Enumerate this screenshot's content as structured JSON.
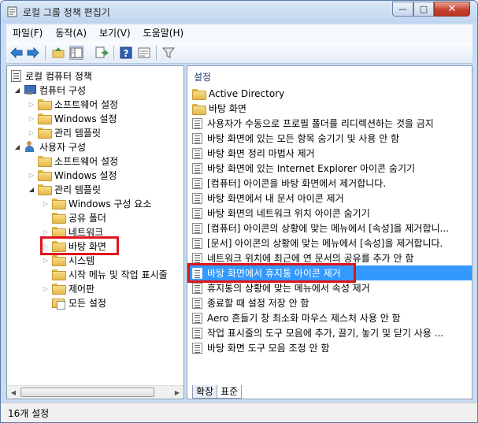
{
  "window": {
    "title": "로컬 그룹 정책 편집기"
  },
  "window_buttons": {
    "minimize": "—",
    "maximize": "□",
    "close": "✕"
  },
  "menu": [
    "파일(F)",
    "동작(A)",
    "보기(V)",
    "도움말(H)"
  ],
  "toolbar_icons": [
    "back-icon",
    "forward-icon",
    "up-folder-icon",
    "show-hide-tree-icon",
    "export-list-icon",
    "help-icon",
    "properties-icon",
    "filter-icon"
  ],
  "tree": {
    "root": "로컬 컴퓨터 정책",
    "items": [
      {
        "label": "컴퓨터 구성",
        "level": 1,
        "expander": "open",
        "icon": "computer"
      },
      {
        "label": "소프트웨어 설정",
        "level": 2,
        "expander": "closed",
        "icon": "folder"
      },
      {
        "label": "Windows 설정",
        "level": 2,
        "expander": "closed",
        "icon": "folder"
      },
      {
        "label": "관리 템플릿",
        "level": 2,
        "expander": "closed",
        "icon": "folder"
      },
      {
        "label": "사용자 구성",
        "level": 1,
        "expander": "open",
        "icon": "user"
      },
      {
        "label": "소프트웨어 설정",
        "level": 2,
        "expander": "none",
        "icon": "folder"
      },
      {
        "label": "Windows 설정",
        "level": 2,
        "expander": "closed",
        "icon": "folder"
      },
      {
        "label": "관리 템플릿",
        "level": 2,
        "expander": "open",
        "icon": "folder"
      },
      {
        "label": "Windows 구성 요소",
        "level": 3,
        "expander": "closed",
        "icon": "folder"
      },
      {
        "label": "공유 폴더",
        "level": 3,
        "expander": "none",
        "icon": "folder"
      },
      {
        "label": "네트워크",
        "level": 3,
        "expander": "closed",
        "icon": "folder"
      },
      {
        "label": "바탕 화면",
        "level": 3,
        "expander": "closed",
        "icon": "folder",
        "highlighted": true
      },
      {
        "label": "시스템",
        "level": 3,
        "expander": "closed",
        "icon": "folder"
      },
      {
        "label": "시작 메뉴 및 작업 표시줄",
        "level": 3,
        "expander": "none",
        "icon": "folder"
      },
      {
        "label": "제어판",
        "level": 3,
        "expander": "closed",
        "icon": "folder"
      },
      {
        "label": "모든 설정",
        "level": 3,
        "expander": "none",
        "icon": "special-folder"
      }
    ]
  },
  "list": {
    "header": "설정",
    "items": [
      {
        "label": "Active Directory",
        "icon": "folder"
      },
      {
        "label": "바탕 화면",
        "icon": "folder"
      },
      {
        "label": "사용자가 수동으로 프로필 폴더를 리디렉션하는 것을 금지",
        "icon": "policy"
      },
      {
        "label": "바탕 화면에 있는 모든 항목 숨기기 및 사용 안 함",
        "icon": "policy"
      },
      {
        "label": "바탕 화면 정리 마법사 제거",
        "icon": "policy"
      },
      {
        "label": "바탕 화면에 있는 Internet Explorer 아이콘 숨기기",
        "icon": "policy"
      },
      {
        "label": "[컴퓨터] 아이콘을 바탕 화면에서 제거합니다.",
        "icon": "policy"
      },
      {
        "label": "바탕 화면에서 내 문서 아이콘 제거",
        "icon": "policy"
      },
      {
        "label": "바탕 화면의 네트워크 위치 아이콘 숨기기",
        "icon": "policy"
      },
      {
        "label": "[컴퓨터] 아이콘의 상황에 맞는 메뉴에서 [속성]을 제거합니...",
        "icon": "policy"
      },
      {
        "label": "[문서] 아이콘의 상황에 맞는 메뉴에서 [속성]을 제거합니다.",
        "icon": "policy"
      },
      {
        "label": "네트워크 위치에 최근에 연 문서의 공유를 추가 안 함",
        "icon": "policy"
      },
      {
        "label": "바탕 화면에서 휴지통 아이콘 제거",
        "icon": "policy",
        "selected": true,
        "highlighted": true
      },
      {
        "label": "휴지통의 상황에 맞는 메뉴에서 속성 제거",
        "icon": "policy"
      },
      {
        "label": "종료할 때 설정 저장 안 함",
        "icon": "policy"
      },
      {
        "label": "Aero 흔들기 창 최소화 마우스 제스처 사용 안 함",
        "icon": "policy"
      },
      {
        "label": "작업 표시줄의 도구 모음에 추가, 끌기, 놓기 및 닫기 사용 ...",
        "icon": "policy"
      },
      {
        "label": "바탕 화면 도구 모음 조정 안 함",
        "icon": "policy"
      }
    ]
  },
  "tabs": [
    "확장",
    "표준"
  ],
  "active_tab": "표준",
  "status": {
    "text": "16개 설정"
  },
  "colors": {
    "selection": "#3399ff",
    "highlight_box": "#e0141a",
    "folder": "#e6b84b"
  }
}
